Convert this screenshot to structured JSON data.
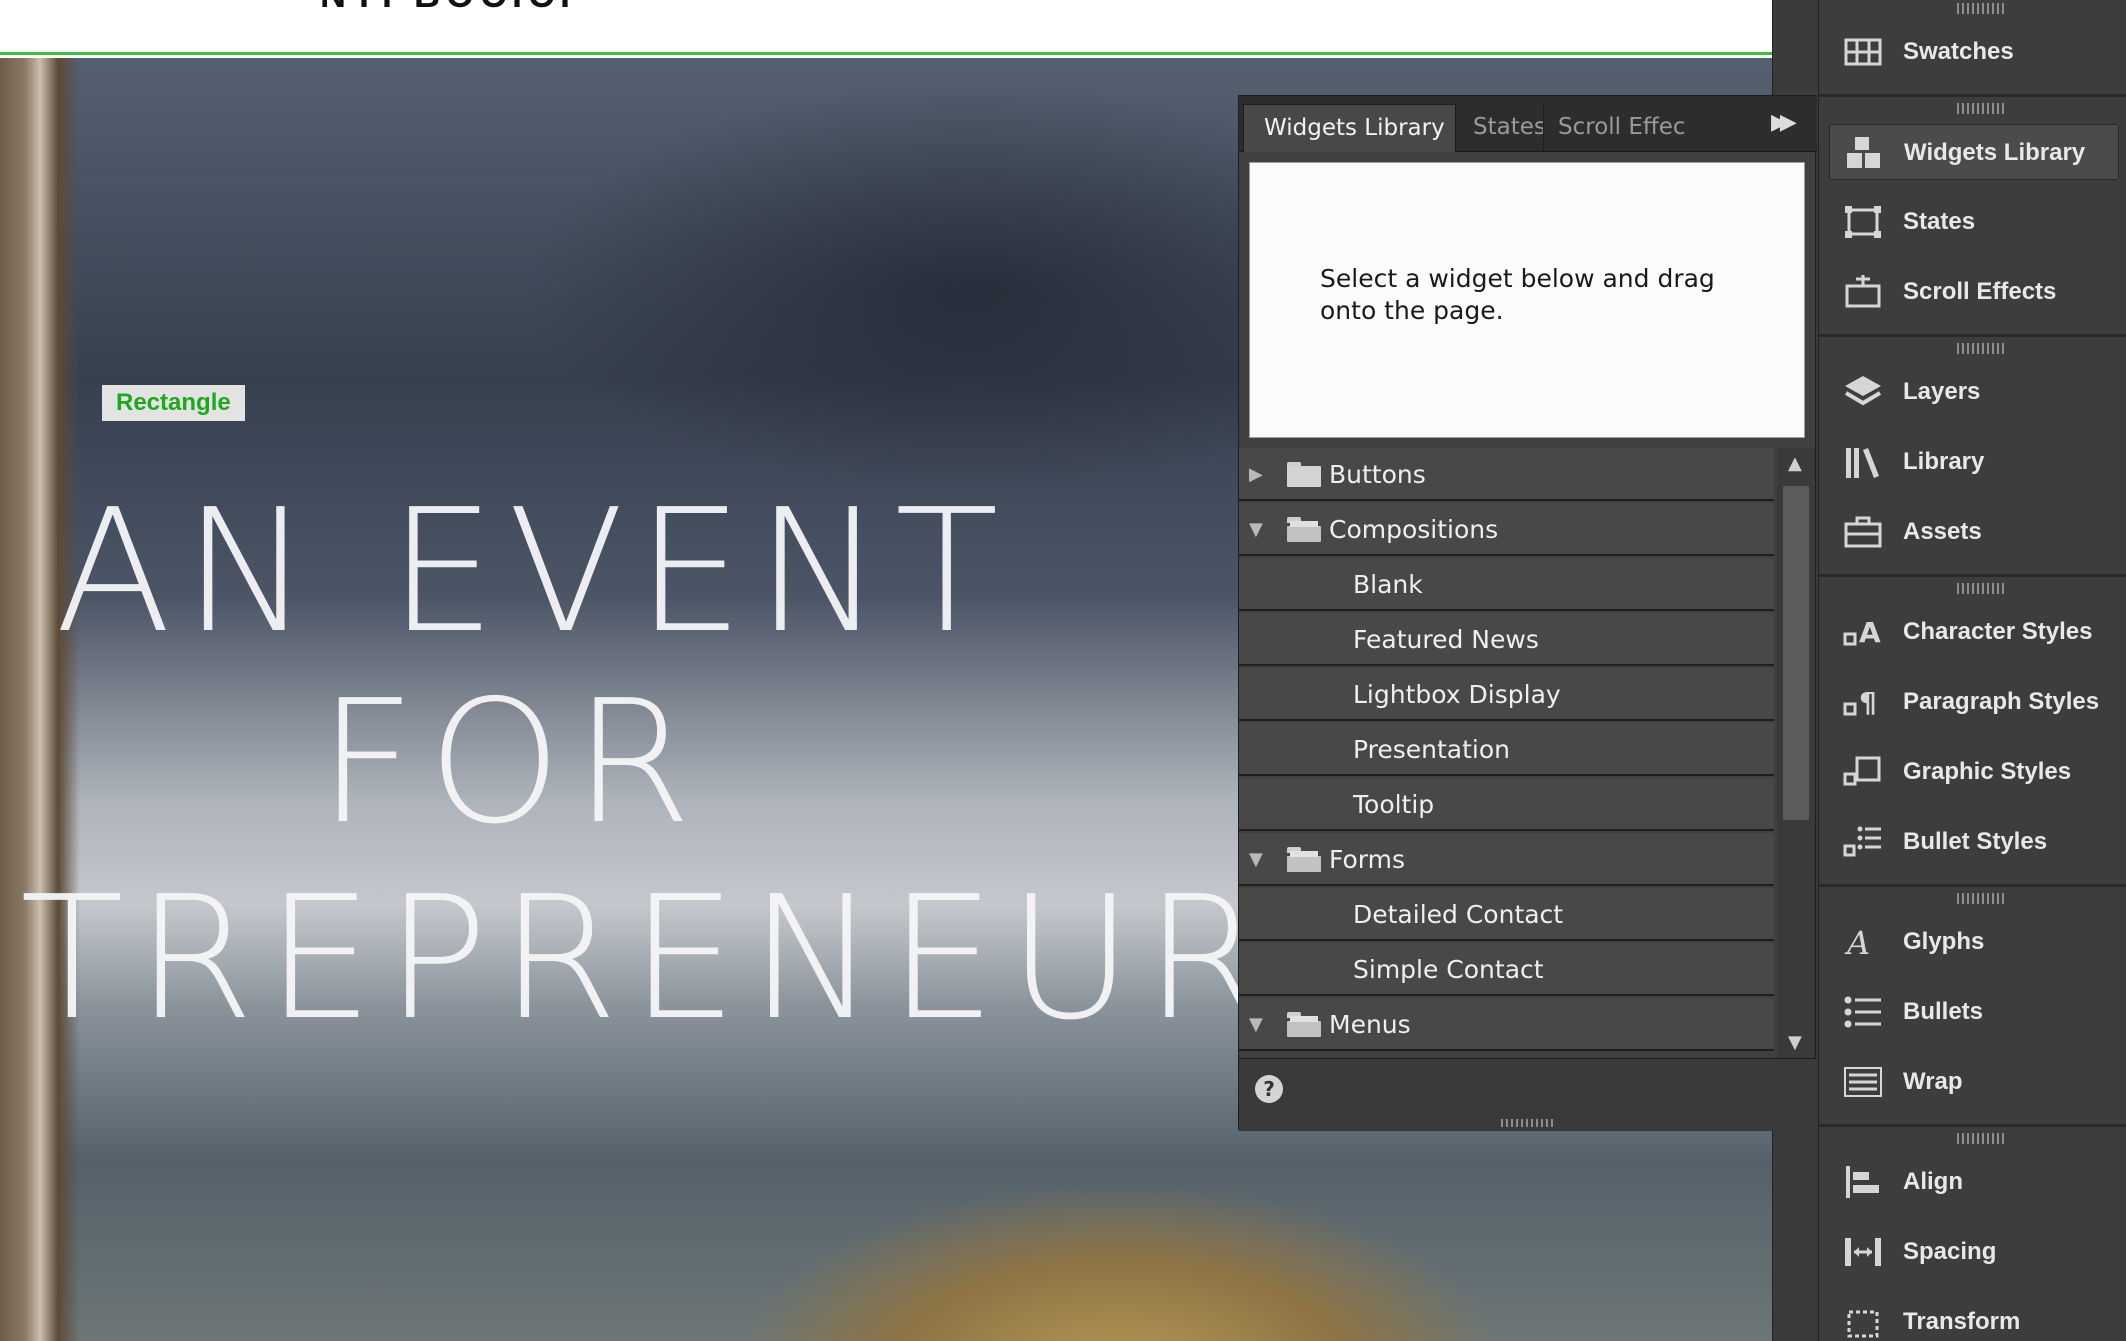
{
  "canvas": {
    "header_cut_text": "NYI BOCICI",
    "selection_label": "Rectangle",
    "hero_lines": [
      "AN EVENT",
      "FOR",
      "TREPRENEURS"
    ]
  },
  "widgets_panel": {
    "tabs": [
      {
        "label": "Widgets Library",
        "active": true
      },
      {
        "label": "States",
        "active": false
      },
      {
        "label": "Scroll Effect",
        "active": false
      }
    ],
    "expand_icon": "double-chevron-right-icon",
    "preview_text": "Select a widget below and drag onto the page.",
    "list": [
      {
        "label": "Buttons",
        "type": "folder",
        "expanded": false
      },
      {
        "label": "Compositions",
        "type": "folder",
        "expanded": true
      },
      {
        "label": "Blank",
        "type": "item"
      },
      {
        "label": "Featured News",
        "type": "item"
      },
      {
        "label": "Lightbox Display",
        "type": "item"
      },
      {
        "label": "Presentation",
        "type": "item"
      },
      {
        "label": "Tooltip",
        "type": "item"
      },
      {
        "label": "Forms",
        "type": "folder",
        "expanded": true
      },
      {
        "label": "Detailed Contact",
        "type": "item"
      },
      {
        "label": "Simple Contact",
        "type": "item"
      },
      {
        "label": "Menus",
        "type": "folder",
        "expanded": true
      }
    ],
    "help_label": "?"
  },
  "right_dock": {
    "groups": [
      [
        {
          "label": "Swatches",
          "icon": "swatches-icon"
        }
      ],
      [
        {
          "label": "Widgets Library",
          "icon": "widgets-library-icon",
          "active": true
        },
        {
          "label": "States",
          "icon": "states-icon"
        },
        {
          "label": "Scroll Effects",
          "icon": "scroll-effects-icon"
        }
      ],
      [
        {
          "label": "Layers",
          "icon": "layers-icon"
        },
        {
          "label": "Library",
          "icon": "library-icon"
        },
        {
          "label": "Assets",
          "icon": "assets-icon"
        }
      ],
      [
        {
          "label": "Character Styles",
          "icon": "character-styles-icon"
        },
        {
          "label": "Paragraph Styles",
          "icon": "paragraph-styles-icon"
        },
        {
          "label": "Graphic Styles",
          "icon": "graphic-styles-icon"
        },
        {
          "label": "Bullet Styles",
          "icon": "bullet-styles-icon"
        }
      ],
      [
        {
          "label": "Glyphs",
          "icon": "glyphs-icon"
        },
        {
          "label": "Bullets",
          "icon": "bullets-icon"
        },
        {
          "label": "Wrap",
          "icon": "wrap-icon"
        }
      ],
      [
        {
          "label": "Align",
          "icon": "align-icon"
        },
        {
          "label": "Spacing",
          "icon": "spacing-icon"
        },
        {
          "label": "Transform",
          "icon": "transform-icon"
        }
      ]
    ]
  },
  "colors": {
    "selection_green": "#1ea81e",
    "panel_bg": "#404040",
    "dock_bg": "#3d3d3d",
    "text_light": "#e8e8e8"
  }
}
